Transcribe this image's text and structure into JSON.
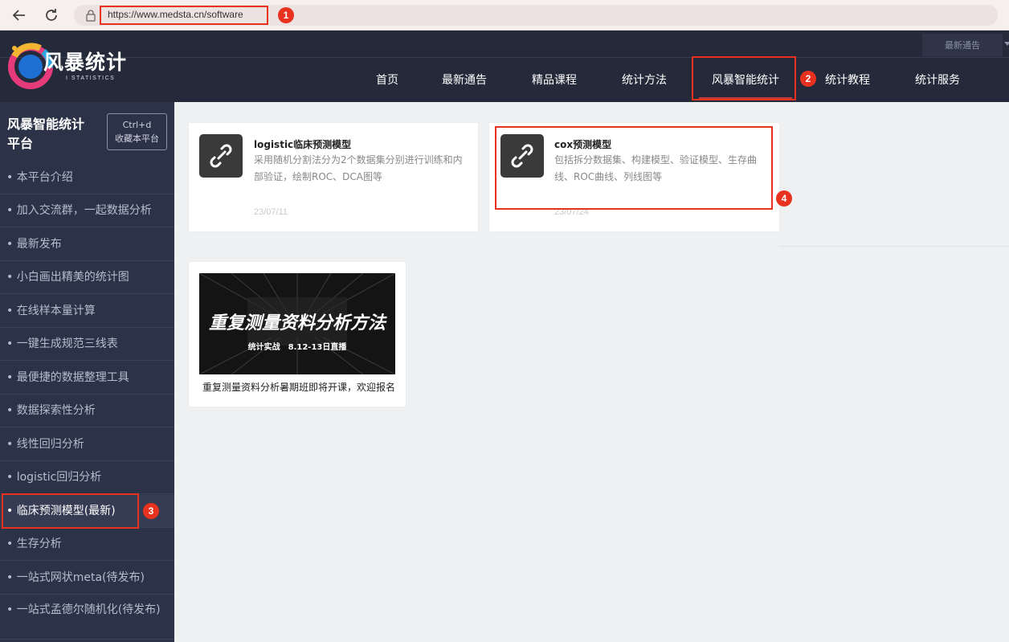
{
  "browser": {
    "url": "https://www.medsta.cn/software"
  },
  "header": {
    "logo_text": "风暴统计",
    "logo_sub": "I STATISTICS",
    "notice_label": "最新通告",
    "nav": [
      "首页",
      "最新通告",
      "精品课程",
      "统计方法",
      "风暴智能统计",
      "统计教程",
      "统计服务"
    ]
  },
  "sidebar": {
    "title": "风暴智能统计平台",
    "bookmark_line1": "Ctrl+d",
    "bookmark_line2": "收藏本平台",
    "items": [
      "• 本平台介绍",
      "• 加入交流群，一起数据分析",
      "• 最新发布",
      "• 小白画出精美的统计图",
      "• 在线样本量计算",
      "• 一键生成规范三线表",
      "• 最便捷的数据整理工具",
      "• 数据探索性分析",
      "• 线性回归分析",
      "• logistic回归分析",
      "• 临床预测模型(最新)",
      "• 生存分析",
      "• 一站式网状meta(待发布)",
      "• 一站式孟德尔随机化(待发布)"
    ]
  },
  "cards": [
    {
      "title": "logistic临床预测模型",
      "desc": "采用随机分割法分为2个数据集分别进行训练和内部验证，绘制ROC、DCA图等",
      "date": "23/07/11"
    },
    {
      "title": "cox预测模型",
      "desc": "包括拆分数据集、构建模型、验证模型、生存曲线、ROC曲线、列线图等",
      "date": "23/07/24"
    }
  ],
  "banner": {
    "title": "重复测量资料分析方法",
    "sub": "统计实战　8.12-13日直播",
    "caption": "重复测量资料分析暑期班即将开课，欢迎报名"
  },
  "annotations": [
    "1",
    "2",
    "3",
    "4"
  ],
  "colors": {
    "header_bg": "#252a3a",
    "sidebar_bg": "#2c3248",
    "annotation_red": "#e8321f",
    "active_underline": "#c23a3a"
  }
}
